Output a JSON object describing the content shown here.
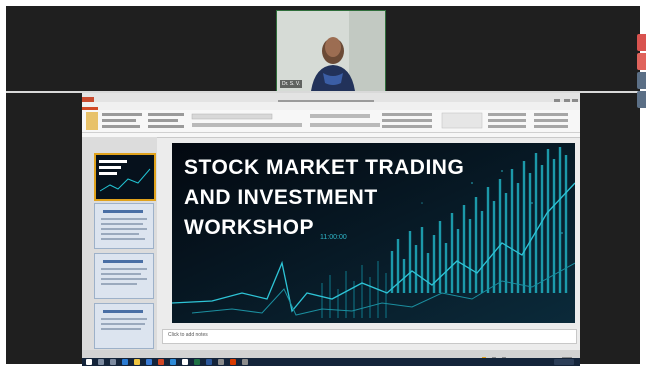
{
  "slide": {
    "title_line1": "STOCK MARKET TRADING",
    "title_line2": "AND INVESTMENT",
    "title_line3": "WORKSHOP",
    "time_label": "11:00:00"
  },
  "notes": {
    "placeholder": "Click to add notes"
  },
  "participant": {
    "name": "Dr. S. V."
  }
}
